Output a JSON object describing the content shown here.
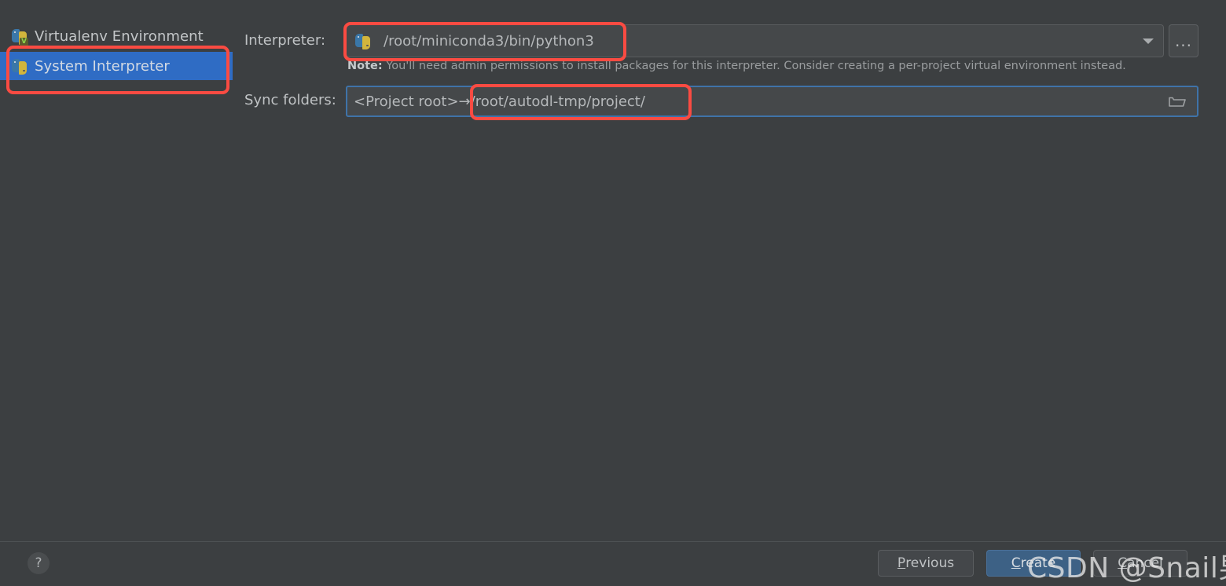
{
  "env_list": {
    "items": [
      {
        "label": "Virtualenv Environment",
        "icon": "python-venv-icon",
        "selected": false,
        "badge": "V"
      },
      {
        "label": "System Interpreter",
        "icon": "python-icon",
        "selected": true
      }
    ]
  },
  "form": {
    "interpreter": {
      "label": "Interpreter:",
      "value": "/root/miniconda3/bin/python3",
      "icon": "python-icon",
      "dropdown_icon": "chevron-down-icon",
      "browse_label": "...",
      "note_prefix": "Note:",
      "note_text": "You'll need admin permissions to install packages for this interpreter. Consider creating a per-project virtual environment instead."
    },
    "sync_folders": {
      "label": "Sync folders:",
      "value": "<Project root>→/root/autodl-tmp/project/",
      "folder_icon": "folder-icon"
    }
  },
  "footer": {
    "help_label": "?",
    "previous": {
      "mnemonic": "P",
      "rest": "revious"
    },
    "create": {
      "mnemonic": "C",
      "rest": "reate"
    },
    "cancel": {
      "mnemonic": "C",
      "rest": "ancel"
    }
  },
  "watermark": {
    "text": "CSDN @Snail男孩"
  },
  "colors": {
    "background": "#3c3f41",
    "selection_blue": "#2f6cc4",
    "annotation_red": "#fa4b42",
    "field_background": "#45484a",
    "focus_border": "#3f73a8",
    "primary_button": "#3d6185"
  }
}
